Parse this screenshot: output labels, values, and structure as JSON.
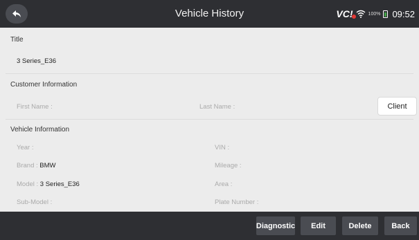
{
  "header": {
    "title": "Vehicle History",
    "vci_label": "VC!",
    "battery_percent": "100%",
    "time": "09:52"
  },
  "title_section": {
    "heading": "Title",
    "value": "3 Series_E36"
  },
  "customer": {
    "heading": "Customer Information",
    "first_name_label": "First Name :",
    "first_name_value": "",
    "last_name_label": "Last Name :",
    "last_name_value": "",
    "client_button": "Client"
  },
  "vehicle": {
    "heading": "Vehicle Information",
    "year_label": "Year :",
    "year_value": "",
    "vin_label": "VIN :",
    "vin_value": "",
    "brand_label": "Brand :",
    "brand_value": "BMW",
    "mileage_label": "Mileage :",
    "mileage_value": "",
    "model_label": "Model :",
    "model_value": "3 Series_E36",
    "area_label": "Area :",
    "area_value": "",
    "submodel_label": "Sub-Model :",
    "submodel_value": "",
    "plate_label": "Plate Number :",
    "plate_value": ""
  },
  "footer": {
    "diagnostic": "Diagnostic",
    "edit": "Edit",
    "delete": "Delete",
    "back": "Back"
  }
}
